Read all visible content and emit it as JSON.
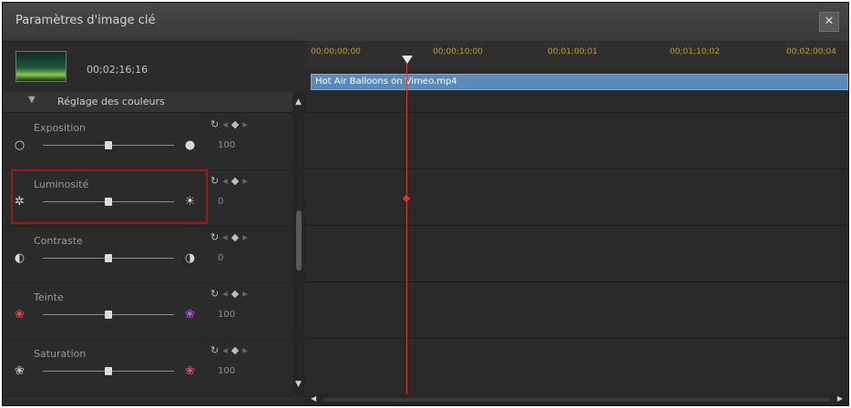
{
  "window": {
    "title": "Paramètres d'image clé",
    "close_label": "✕"
  },
  "clip": {
    "time": "00;02;16;16",
    "thumbnail": "hot-air-balloon-landscape"
  },
  "section": {
    "label": "Réglage des couleurs",
    "toggle": "▼"
  },
  "keyframe_controls": {
    "reset": "↻",
    "prev": "◂",
    "add": "◆",
    "next": "▸"
  },
  "properties": [
    {
      "name": "Exposition",
      "value": "100",
      "left_icon": "○",
      "right_icon": "●"
    },
    {
      "name": "Luminosité",
      "value": "0",
      "left_icon": "✲",
      "right_icon": "☀"
    },
    {
      "name": "Contraste",
      "value": "0",
      "left_icon": "◐",
      "right_icon": "◑"
    },
    {
      "name": "Teinte",
      "value": "100",
      "left_icon": "❀",
      "right_icon": "❀"
    },
    {
      "name": "Saturation",
      "value": "100",
      "left_icon": "❀",
      "right_icon": "❀"
    }
  ],
  "timeline": {
    "ticks": [
      "00;00;00;00",
      "00;00;10;00",
      "00;01;00;01",
      "00;01;10;02",
      "00;02;00;04"
    ],
    "clip_name": "Hot Air Balloons on Vimeo.mp4"
  },
  "scroll": {
    "up": "▲",
    "down": "▼",
    "left": "◀",
    "right": "▶"
  },
  "colors": {
    "accent_highlight": "#9a1c1c",
    "playhead": "#d33a2c",
    "clip": "#5b8ab8",
    "ruler_text": "#c79a2a"
  }
}
